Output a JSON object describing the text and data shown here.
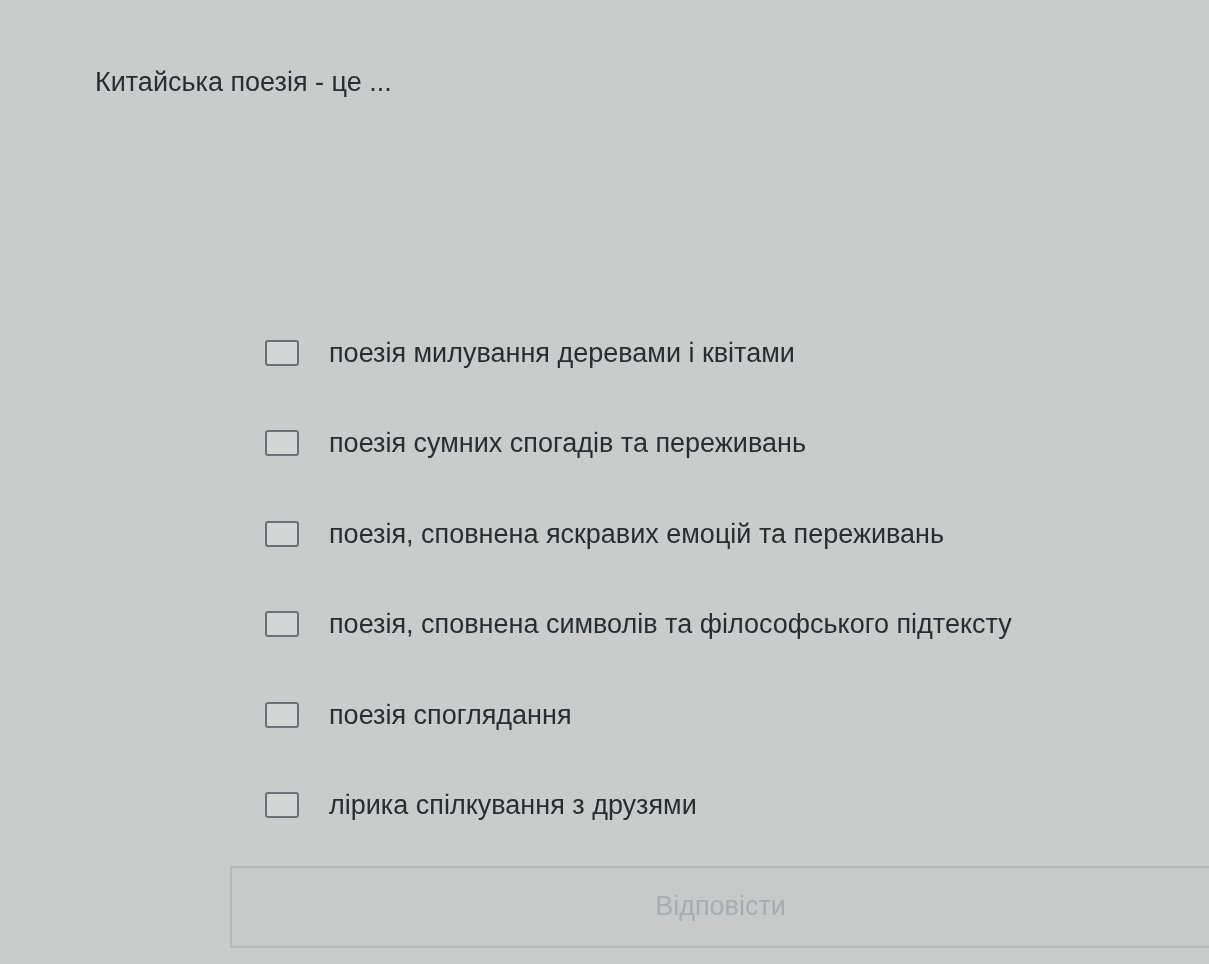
{
  "question": "Китайська поезія - це ...",
  "options": [
    {
      "label": "поезія милування деревами і квітами",
      "checked": false
    },
    {
      "label": "поезія сумних спогадів та переживань",
      "checked": false
    },
    {
      "label": "поезія, сповнена яскравих емоцій та переживань",
      "checked": false
    },
    {
      "label": "поезія, сповнена символів та філософського підтексту",
      "checked": false
    },
    {
      "label": "поезія споглядання",
      "checked": false
    },
    {
      "label": "лірика спілкування з друзями",
      "checked": false
    }
  ],
  "submit": {
    "label": "Відповісти",
    "disabled": true
  }
}
